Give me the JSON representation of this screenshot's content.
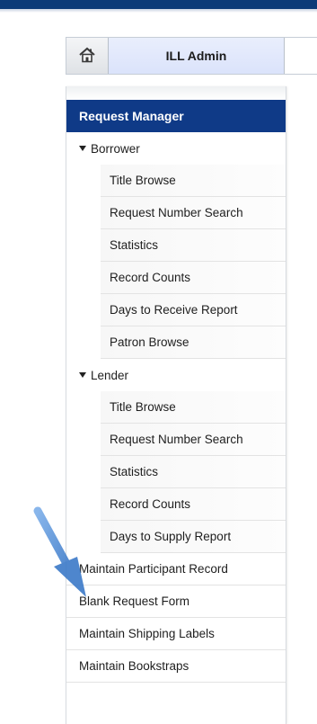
{
  "tabs": {
    "home_icon": "home-icon",
    "admin_label": "ILL Admin"
  },
  "sidebar": {
    "header": "Request Manager",
    "borrower": {
      "label": "Borrower",
      "items": [
        "Title Browse",
        "Request Number Search",
        "Statistics",
        "Record Counts",
        "Days to Receive Report",
        "Patron Browse"
      ]
    },
    "lender": {
      "label": "Lender",
      "items": [
        "Title Browse",
        "Request Number Search",
        "Statistics",
        "Record Counts",
        "Days to Supply Report"
      ]
    },
    "links": [
      "Maintain Participant Record",
      "Blank Request Form",
      "Maintain Shipping Labels",
      "Maintain Bookstraps"
    ]
  },
  "colors": {
    "topbar": "#0c3a78",
    "header": "#0f3a87",
    "admin_tab": "#dbe3fb",
    "arrow": "#4a86d2"
  }
}
